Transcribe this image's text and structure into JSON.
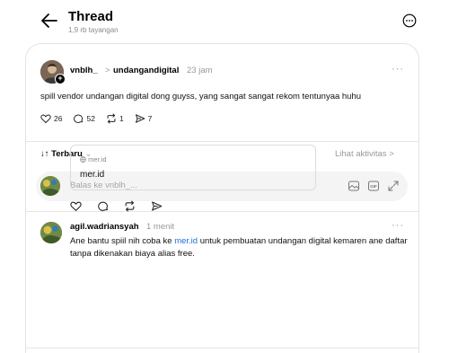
{
  "header": {
    "title": "Thread",
    "views": "1,9 rb tayangan"
  },
  "post": {
    "username": "vnblh_",
    "separator": ">",
    "reply_to": "undangandigital",
    "time": "23 jam",
    "more": "···",
    "text": "spill vendor undangan digital dong guyss, yang sangat sangat rekom tentunyaa huhu",
    "likes": "26",
    "comments": "52",
    "reposts": "1",
    "shares": "7"
  },
  "sort": {
    "label": "↓↑ Terbaru",
    "chevron": "⌄",
    "activity": "Lihat aktivitas >"
  },
  "reply": {
    "placeholder": "Balas ke vnblh_..."
  },
  "comment": {
    "username": "agil.wadriansyah",
    "time": "1 menit",
    "more": "···",
    "text_before": "Ane bantu spiil nih coba ke ",
    "link": "mer.id",
    "text_after": " untuk pembuatan undangan digital kemaren ane daftar tanpa dikenakan biaya alias free.",
    "preview_domain": "mer.id",
    "preview_title": "mer.id"
  },
  "colors": {
    "link": "#1e6fe0",
    "muted": "#999999"
  }
}
